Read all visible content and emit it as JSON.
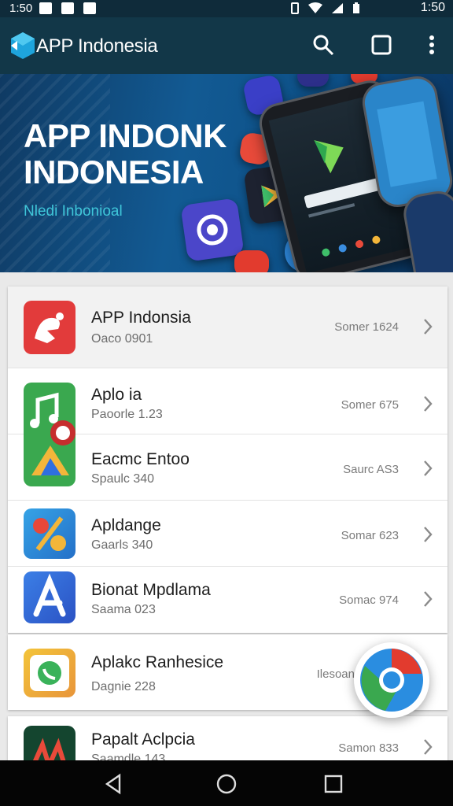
{
  "status_bar": {
    "time_left": "1:50",
    "time_right": "1:50"
  },
  "app_bar": {
    "title": "APP Indonesia",
    "icons": [
      "search-icon",
      "square-icon",
      "more-vert-icon"
    ]
  },
  "banner": {
    "title_line1": "APP INDONK",
    "title_line2": "INDONESIA",
    "subtitle": "Nledi Inbonioal"
  },
  "apps": [
    {
      "name": "APP Indonsia",
      "sub": "Oaco 0901",
      "meta": "Somer 1624",
      "icon": "app-indonesia-icon"
    },
    {
      "name": "Aplo ia",
      "sub": "Paoorle 1.23",
      "meta": "Somer 675",
      "icon": "music-ball-icon"
    },
    {
      "name": "Eacmc Entoo",
      "sub": "Spaulc 340",
      "meta": "Saurc AS3",
      "icon": "play-triangle-icon"
    },
    {
      "name": "Apldange",
      "sub": "Gaarls 340",
      "meta": "Somar 623",
      "icon": "percent-app-icon"
    },
    {
      "name": "Bionat Mpdlama",
      "sub": "Saama 023",
      "meta": "Somac 974",
      "icon": "letter-a-icon"
    },
    {
      "name": "Aplakc Ranhesice",
      "sub": "Dagnie 228",
      "meta": "Ilesoan",
      "icon": "chat-bubble-icon"
    },
    {
      "name": "Papalt Aclpcia",
      "sub": "Saamdle 143",
      "meta": "Samon 833",
      "icon": "aa-logo-icon"
    }
  ],
  "colors": {
    "app_bar": "#123748",
    "status_bar": "#0f2b3a",
    "banner_accent": "#3fc6d9"
  }
}
